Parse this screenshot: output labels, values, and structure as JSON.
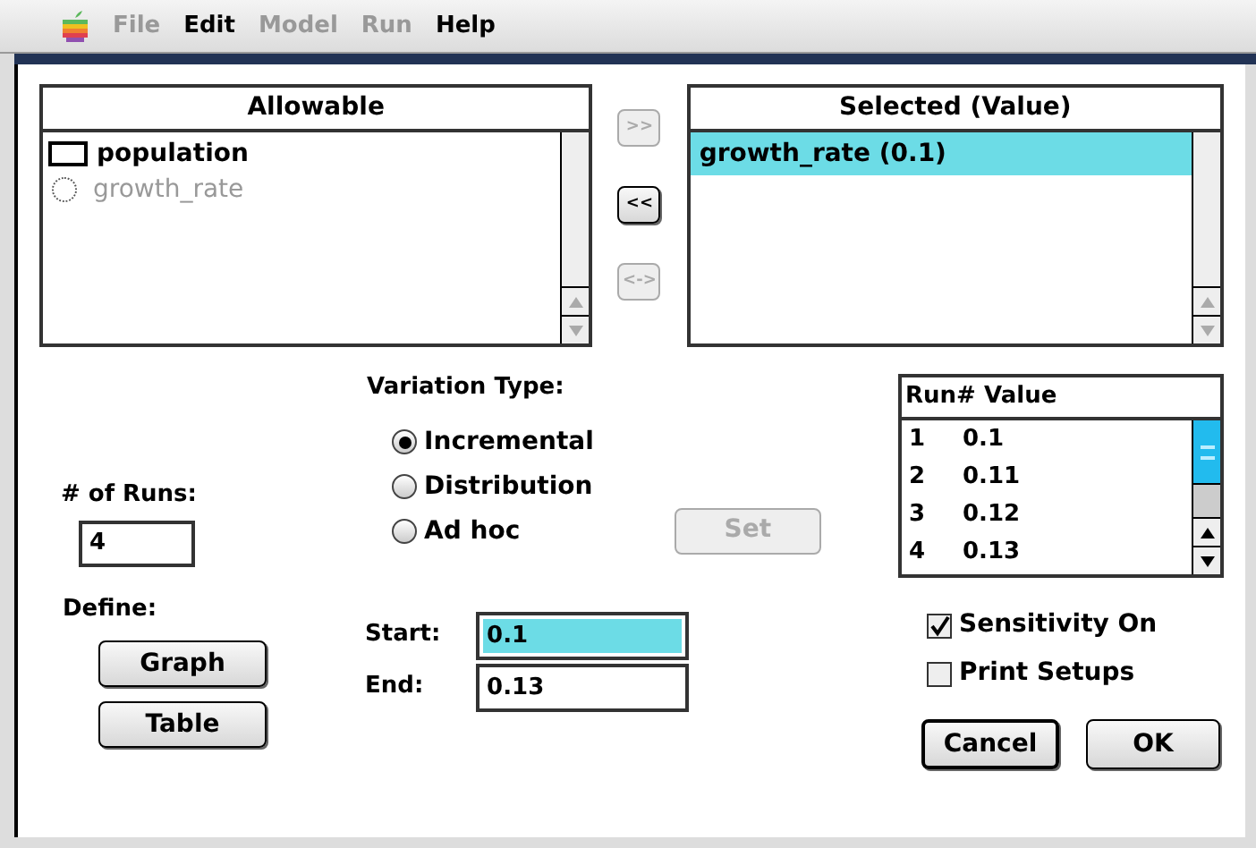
{
  "menu": [
    {
      "label": "File",
      "disabled": true
    },
    {
      "label": "Edit",
      "disabled": false
    },
    {
      "label": "Model",
      "disabled": true
    },
    {
      "label": "Run",
      "disabled": true
    },
    {
      "label": "Help",
      "disabled": false
    }
  ],
  "allowable": {
    "title": "Allowable",
    "items": [
      {
        "label": "population",
        "kind": "box",
        "disabled": false
      },
      {
        "label": "growth_rate",
        "kind": "circle",
        "disabled": true
      }
    ]
  },
  "transfer_buttons": [
    {
      "label": ">>",
      "disabled": true
    },
    {
      "label": "<<",
      "disabled": false
    },
    {
      "label": "<->",
      "disabled": true
    }
  ],
  "selected_list": {
    "title": "Selected (Value)",
    "items": [
      {
        "label": "growth_rate (0.1)",
        "selected": true
      }
    ]
  },
  "variation_type": {
    "label": "Variation Type:",
    "options": [
      {
        "label": "Incremental",
        "selected": true
      },
      {
        "label": "Distribution",
        "selected": false
      },
      {
        "label": "Ad hoc",
        "selected": false
      }
    ]
  },
  "runs": {
    "label": "# of Runs:",
    "value": "4"
  },
  "define": {
    "label": "Define:",
    "buttons": [
      "Graph",
      "Table"
    ]
  },
  "start": {
    "label": "Start:",
    "value": "0.1",
    "selected": true
  },
  "end": {
    "label": "End:",
    "value": "0.13",
    "selected": false
  },
  "set_button": {
    "label": "Set",
    "disabled": true
  },
  "run_table": {
    "columns": [
      "Run#",
      "Value"
    ],
    "rows": [
      [
        "1",
        "0.1"
      ],
      [
        "2",
        "0.11"
      ],
      [
        "3",
        "0.12"
      ],
      [
        "4",
        "0.13"
      ]
    ]
  },
  "options": [
    {
      "label": "Sensitivity On",
      "checked": true
    },
    {
      "label": "Print Setups",
      "checked": false
    }
  ],
  "buttons": [
    "Cancel",
    "OK"
  ]
}
